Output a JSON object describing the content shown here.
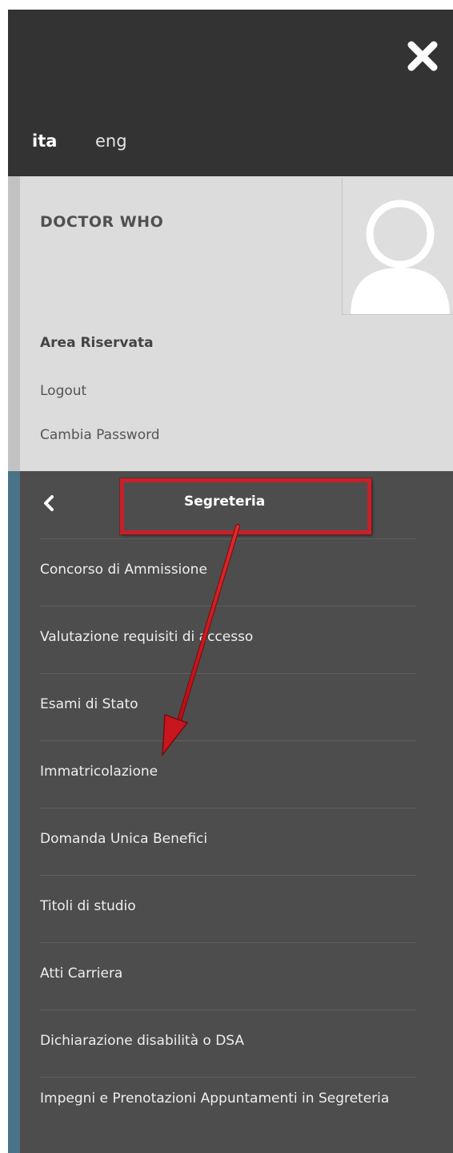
{
  "header": {
    "close_icon": "close-icon",
    "languages": [
      "ita",
      "eng"
    ],
    "active_language": "ita"
  },
  "user": {
    "name": "DOCTOR WHO",
    "avatar_icon": "user-avatar-icon"
  },
  "area": {
    "title": "Area Riservata",
    "links": [
      "Logout",
      "Cambia Password"
    ]
  },
  "nav": {
    "back_icon": "chevron-left-icon",
    "title": "Segreteria",
    "items": [
      "Concorso di Ammissione",
      "Valutazione requisiti di accesso",
      "Esami di Stato",
      "Immatricolazione",
      "Domanda Unica Benefici",
      "Titoli di studio",
      "Atti Carriera",
      "Dichiarazione disabilità o DSA",
      "Impegni e Prenotazioni Appuntamenti in Segreteria"
    ]
  },
  "annotation": {
    "highlight_color": "#c8202a",
    "arrow_color": "#d4141c"
  },
  "colors": {
    "topbar": "#333333",
    "user_panel": "#dcdcdc",
    "nav_bg": "#4d4d4d",
    "nav_stripe": "#4a7288"
  }
}
